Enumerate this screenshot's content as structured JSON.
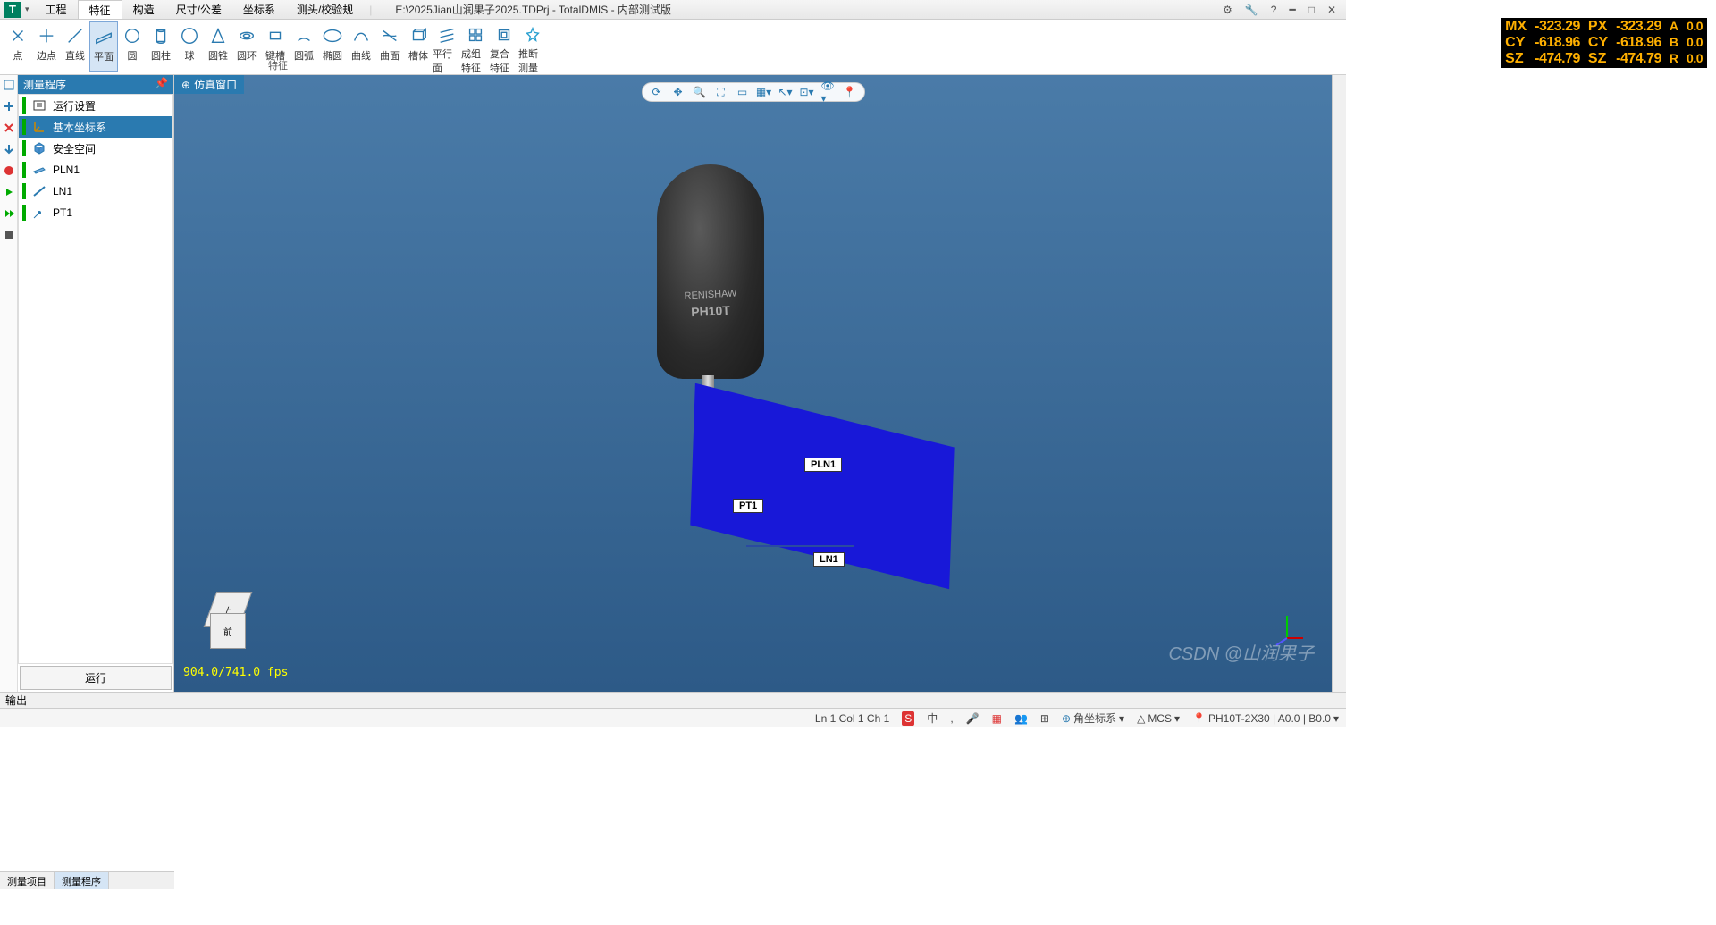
{
  "app": {
    "icon_letter": "T",
    "title_path": "E:\\2025Jian山润果子2025.TDPrj - TotalDMIS - 内部测试版"
  },
  "menus": [
    "工程",
    "特征",
    "构造",
    "尺寸/公差",
    "坐标系",
    "测头/校验规"
  ],
  "active_menu_index": 1,
  "ribbon": {
    "items": [
      "点",
      "边点",
      "直线",
      "平面",
      "圆",
      "圆柱",
      "球",
      "圆锥",
      "圆环",
      "键槽",
      "圆弧",
      "椭圆",
      "曲线",
      "曲面",
      "槽体",
      "平行面",
      "成组特征",
      "复合特征",
      "推断测量"
    ],
    "selected_index": 3,
    "group_title": "特征"
  },
  "led": {
    "rows": [
      {
        "l1": "MX",
        "v1": "-323.29",
        "l2": "PX",
        "v2": "-323.29",
        "l3": "A",
        "v3": "0.0"
      },
      {
        "l1": "CY",
        "v1": "-618.96",
        "l2": "CY",
        "v2": "-618.96",
        "l3": "B",
        "v3": "0.0"
      },
      {
        "l1": "SZ",
        "v1": "-474.79",
        "l2": "SZ",
        "v2": "-474.79",
        "l3": "R",
        "v3": "0.0"
      }
    ]
  },
  "left_panel": {
    "title": "测量程序",
    "items": [
      {
        "label": "运行设置",
        "icon": "settings"
      },
      {
        "label": "基本坐标系",
        "icon": "csys",
        "selected": true
      },
      {
        "label": "安全空间",
        "icon": "cube"
      },
      {
        "label": "PLN1",
        "icon": "plane"
      },
      {
        "label": "LN1",
        "icon": "line"
      },
      {
        "label": "PT1",
        "icon": "point"
      }
    ],
    "run_button": "运行",
    "tabs": [
      "测量项目",
      "测量程序"
    ],
    "active_tab": 1
  },
  "viewport": {
    "tab_title": "仿真窗口",
    "probe_brand": "RENISHAW",
    "probe_model": "PH10T",
    "labels": {
      "pln": "PLN1",
      "pt": "PT1",
      "ln": "LN1"
    },
    "viewcube": {
      "top": "上",
      "front": "前"
    },
    "fps": "904.0/741.0 fps"
  },
  "output_label": "输出",
  "statusbar": {
    "pos": "Ln 1   Col 1   Ch 1",
    "ime": "中",
    "coord": "角坐标系",
    "mcs": "MCS",
    "probe": "PH10T-2X30 | A0.0 | B0.0",
    "watermark": "CSDN @山润果子"
  }
}
